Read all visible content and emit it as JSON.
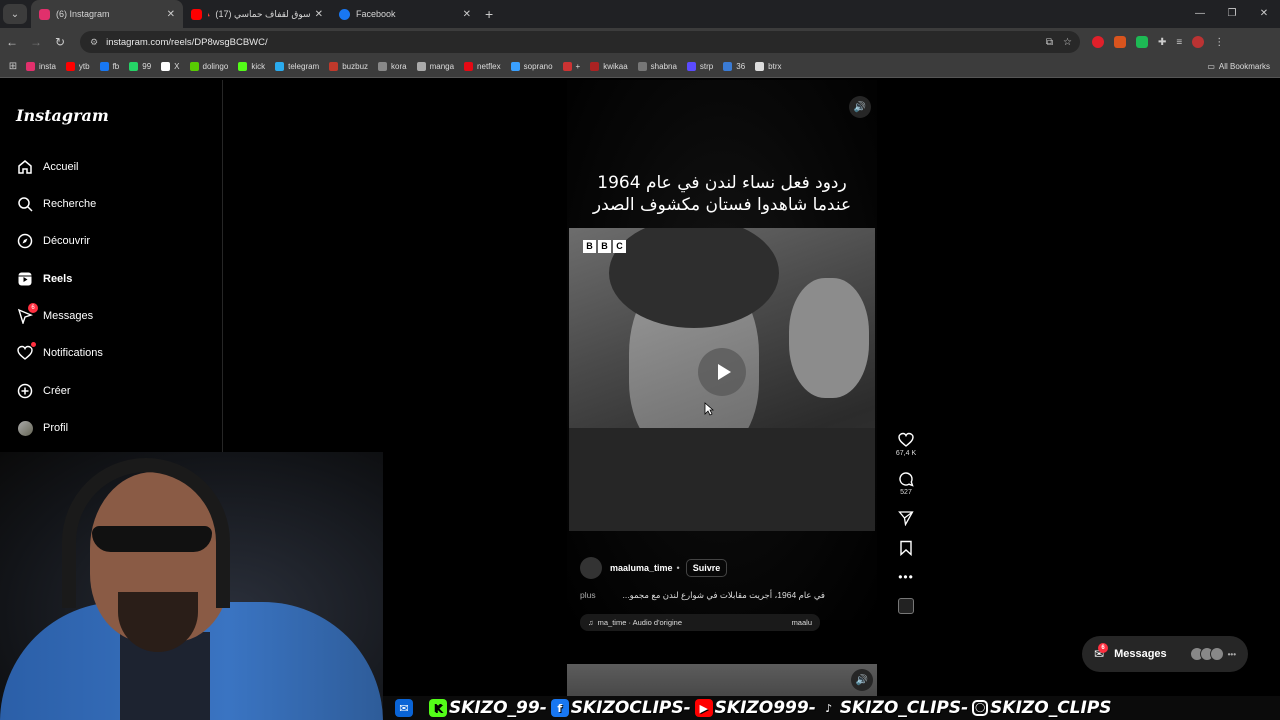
{
  "browser": {
    "tabs": [
      {
        "title": "(6) Instagram",
        "color": "#e1306c"
      },
      {
        "title": "سوق لقفاف حماسي (17) 🔺 رازرا",
        "color": "#ff0000"
      },
      {
        "title": "Facebook",
        "color": "#1877f2"
      }
    ],
    "url": "instagram.com/reels/DP8wsgBCBWC/",
    "bookmarks": [
      {
        "label": "insta",
        "color": "#e1306c"
      },
      {
        "label": "ytb",
        "color": "#ff0000"
      },
      {
        "label": "fb",
        "color": "#1877f2"
      },
      {
        "label": "99",
        "color": "#25d366"
      },
      {
        "label": "X",
        "color": "#ffffff"
      },
      {
        "label": "dolingo",
        "color": "#58cc02"
      },
      {
        "label": "kick",
        "color": "#53fc18"
      },
      {
        "label": "telegram",
        "color": "#2aabee"
      },
      {
        "label": "buzbuz",
        "color": "#c0392b"
      },
      {
        "label": "kora",
        "color": "#888888"
      },
      {
        "label": "manga",
        "color": "#aaaaaa"
      },
      {
        "label": "netflex",
        "color": "#e50914"
      },
      {
        "label": "soprano",
        "color": "#3aa0ff"
      },
      {
        "label": "+",
        "color": "#cc3333"
      },
      {
        "label": "kwikaa",
        "color": "#aa2222"
      },
      {
        "label": "shabna",
        "color": "#777777"
      },
      {
        "label": "strp",
        "color": "#5b4bff"
      },
      {
        "label": "36",
        "color": "#3a7bd5"
      },
      {
        "label": "btrx",
        "color": "#dddddd"
      }
    ],
    "all_bookmarks": "All Bookmarks"
  },
  "sidebar": {
    "logo": "Instagram",
    "items": [
      {
        "label": "Accueil",
        "icon": "home-icon"
      },
      {
        "label": "Recherche",
        "icon": "search-icon"
      },
      {
        "label": "Découvrir",
        "icon": "compass-icon"
      },
      {
        "label": "Reels",
        "icon": "reels-icon"
      },
      {
        "label": "Messages",
        "icon": "messenger-icon",
        "badge": "6"
      },
      {
        "label": "Notifications",
        "icon": "heart-icon"
      },
      {
        "label": "Créer",
        "icon": "plus-icon"
      },
      {
        "label": "Profil",
        "icon": "avatar"
      }
    ]
  },
  "reel": {
    "caption_line1": "ردود فعل نساء لندن في عام 1964",
    "caption_line2": "عندما شاهدوا فستان مكشوف الصدر",
    "likes": "67,4 K",
    "comments": "527",
    "author": "maaluma_time",
    "follow": "Suivre",
    "description": "في عام 1964، أجريت مقابلات في شوارع لندن مع مجمو...",
    "more": "plus",
    "audio": "ma_time · Audio d'origine",
    "audio_right": "maalu"
  },
  "messages_pill": {
    "label": "Messages",
    "badge": "6"
  },
  "overlay": [
    "SKIZO_99",
    "SKIZOCLIPS",
    "SKIZO999",
    "SKIZO_CLIPS",
    "SKIZO_CLIPS"
  ]
}
